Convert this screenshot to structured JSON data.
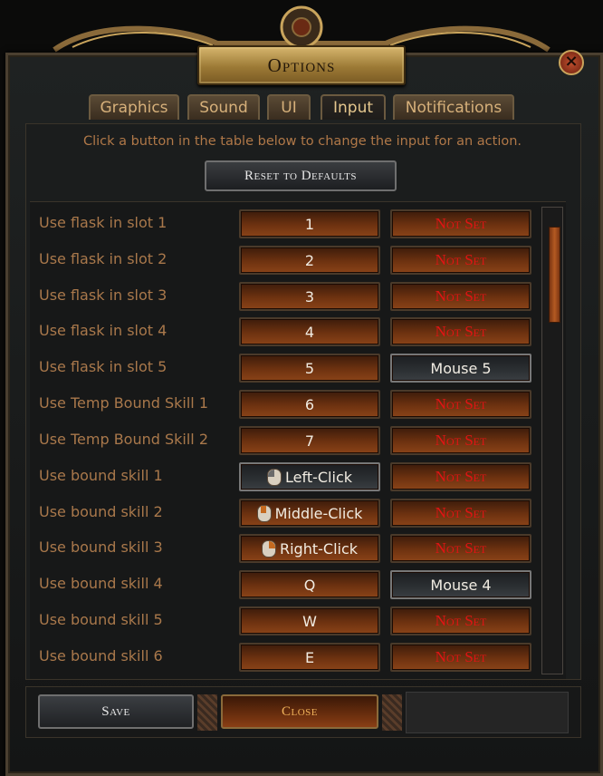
{
  "window": {
    "title": "Options"
  },
  "tabs": [
    {
      "label": "Graphics"
    },
    {
      "label": "Sound"
    },
    {
      "label": "UI"
    },
    {
      "label": "Input",
      "active": true
    },
    {
      "label": "Notifications"
    }
  ],
  "instruction": "Click a button in the table below to change the input for an action.",
  "reset_label": "Reset to Defaults",
  "bindings": [
    {
      "action": "Use flask in slot 1",
      "primary": "1",
      "secondary": "Not Set"
    },
    {
      "action": "Use flask in slot 2",
      "primary": "2",
      "secondary": "Not Set"
    },
    {
      "action": "Use flask in slot 3",
      "primary": "3",
      "secondary": "Not Set"
    },
    {
      "action": "Use flask in slot 4",
      "primary": "4",
      "secondary": "Not Set"
    },
    {
      "action": "Use flask in slot 5",
      "primary": "5",
      "secondary": "Mouse 5"
    },
    {
      "action": "Use Temp Bound Skill 1",
      "primary": "6",
      "secondary": "Not Set"
    },
    {
      "action": "Use Temp Bound Skill 2",
      "primary": "7",
      "secondary": "Not Set"
    },
    {
      "action": "Use bound skill 1",
      "primary": "Left-Click",
      "secondary": "Not Set"
    },
    {
      "action": "Use bound skill 2",
      "primary": "Middle-Click",
      "secondary": "Not Set"
    },
    {
      "action": "Use bound skill 3",
      "primary": "Right-Click",
      "secondary": "Not Set"
    },
    {
      "action": "Use bound skill 4",
      "primary": "Q",
      "secondary": "Mouse 4"
    },
    {
      "action": "Use bound skill 5",
      "primary": "W",
      "secondary": "Not Set"
    },
    {
      "action": "Use bound skill 6",
      "primary": "E",
      "secondary": "Not Set"
    }
  ],
  "footer": {
    "save_label": "Save",
    "close_label": "Close"
  },
  "colors": {
    "not_set": "#e01414",
    "label": "#a9784b",
    "accent": "#8a4318"
  }
}
